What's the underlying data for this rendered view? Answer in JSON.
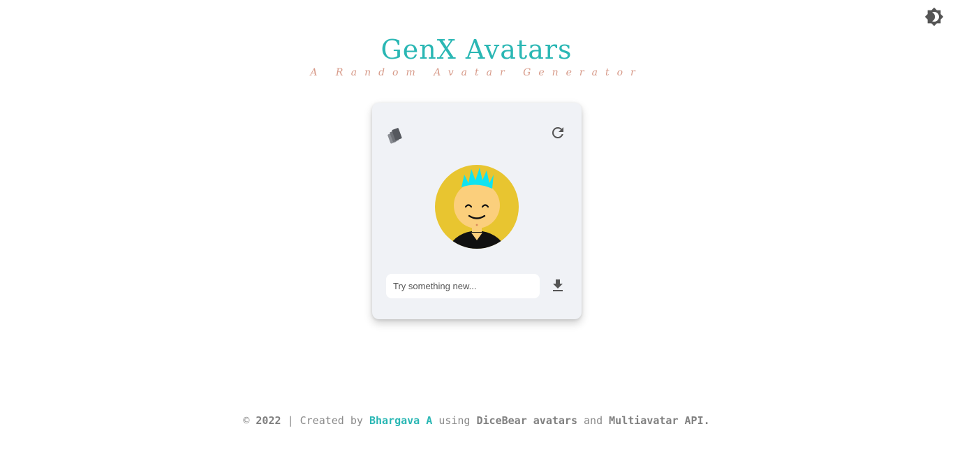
{
  "header": {
    "title": "GenX Avatars",
    "subtitle": "A Random Avatar Generator"
  },
  "theme_toggle": {
    "icon": "brightness-icon"
  },
  "card": {
    "style_icon": "palette-swatch-icon",
    "refresh_icon": "refresh-icon",
    "avatar_icon": "avatar-image",
    "input": {
      "value": "",
      "placeholder": "Try something new..."
    },
    "download_icon": "download-icon"
  },
  "footer": {
    "copyright": "©",
    "year": "2022",
    "separator": "|",
    "created_by": "Created by",
    "author": "Bhargava A",
    "using": "using",
    "dicebear": "DiceBear avatars",
    "and": "and",
    "multiavatar": "Multiavatar API."
  },
  "colors": {
    "accent": "#2ab7b4",
    "subtitle": "#d79a89",
    "card_bg": "#f0f2f6",
    "avatar_bg": "#e8c530",
    "avatar_skin": "#fbcf7c",
    "avatar_hair": "#10e3f0"
  }
}
